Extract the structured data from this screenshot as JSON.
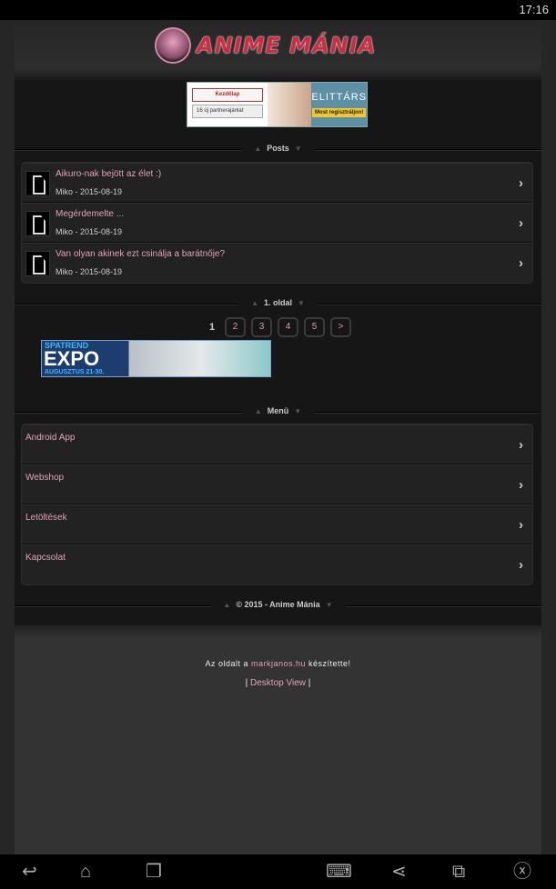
{
  "status_bar": {
    "time": "17:16"
  },
  "header": {
    "logo_text": "ANIME MÁNIA"
  },
  "banner_top": {
    "btn1": "Kezdőlap",
    "btn2": "16 új partnerajánlat",
    "brand": "ELITTÁRS",
    "cta": "Most regisztráljon!"
  },
  "posts": {
    "heading": "Posts",
    "items": [
      {
        "title": "Aikuro-nak bejött az élet :)",
        "meta": "Miko - 2015-08-19"
      },
      {
        "title": "Megérdemelte ...",
        "meta": "Miko - 2015-08-19"
      },
      {
        "title": "Van olyan akinek ezt csinálja a barátnője?",
        "meta": "Miko - 2015-08-19"
      }
    ]
  },
  "pagination": {
    "heading": "1. oldal",
    "current": "1",
    "pages": [
      "2",
      "3",
      "4",
      "5"
    ],
    "next": ">"
  },
  "banner_ad": {
    "line1": "SPATREND",
    "line2": "EXPO",
    "line3": "AUGUSZTUS 21-30."
  },
  "menu": {
    "heading": "Menü",
    "items": [
      "Android App",
      "Webshop",
      "Letöltések",
      "Kapcsolat"
    ]
  },
  "footer": {
    "copyright": "© 2015 - Anime Mánia",
    "credit_pre": "Az oldalt a",
    "credit_link": "markjanos.hu",
    "credit_post": "készítette!",
    "desktop_view": "Desktop View",
    "sep": "|"
  },
  "accent": "#e0a2b8"
}
